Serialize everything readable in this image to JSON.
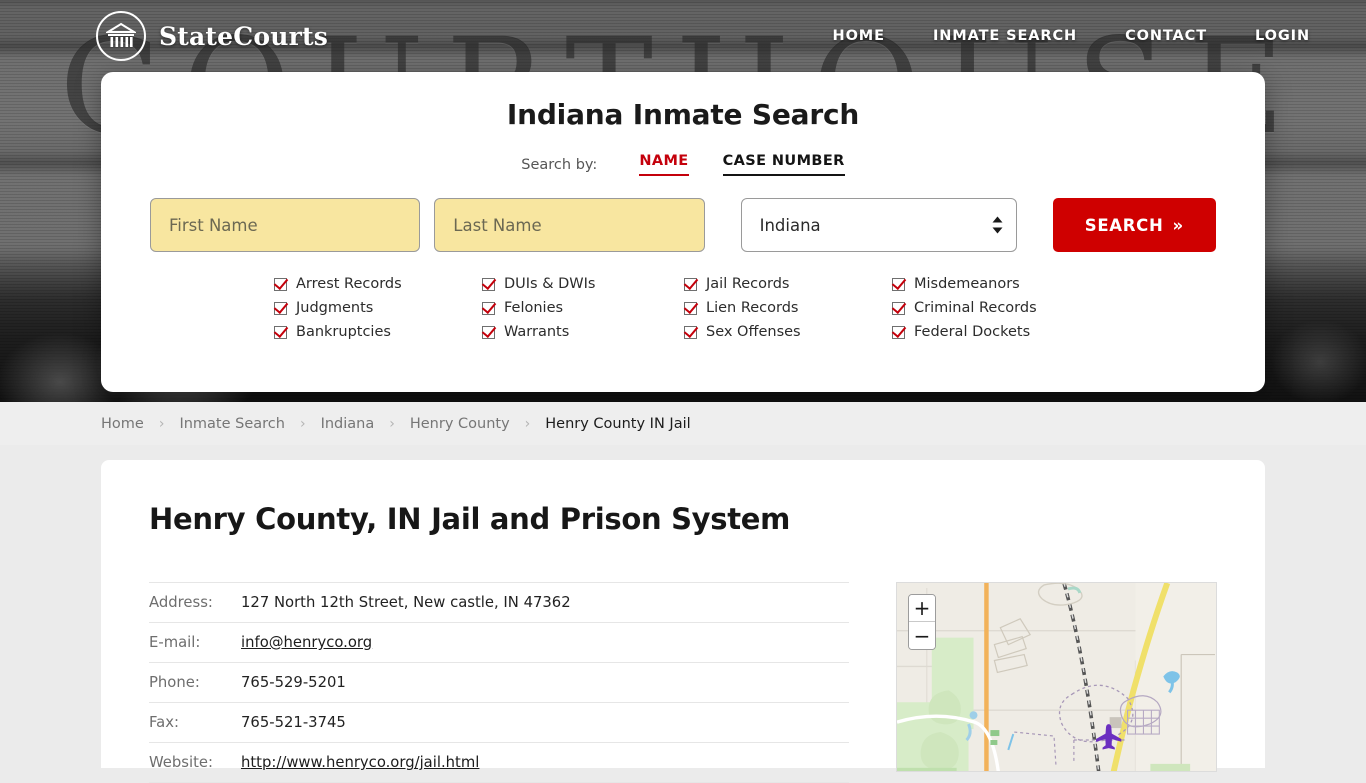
{
  "brand": {
    "name": "StateCourts",
    "logo_icon": "courthouse-circle-icon"
  },
  "nav": [
    {
      "label": "HOME"
    },
    {
      "label": "INMATE SEARCH"
    },
    {
      "label": "CONTACT"
    },
    {
      "label": "LOGIN"
    }
  ],
  "hero": {
    "background_word": "COURTHOUSE"
  },
  "search": {
    "title": "Indiana Inmate Search",
    "search_by_label": "Search by:",
    "tabs": [
      {
        "label": "NAME",
        "active": true
      },
      {
        "label": "CASE NUMBER",
        "active": false
      }
    ],
    "first_name_placeholder": "First Name",
    "last_name_placeholder": "Last Name",
    "state_value": "Indiana",
    "button_label": "SEARCH",
    "button_chevrons": "»",
    "checkboxes": [
      "Arrest Records",
      "DUIs & DWIs",
      "Jail Records",
      "Misdemeanors",
      "Judgments",
      "Felonies",
      "Lien Records",
      "Criminal Records",
      "Bankruptcies",
      "Warrants",
      "Sex Offenses",
      "Federal Dockets"
    ]
  },
  "breadcrumb": {
    "separator": "›",
    "items": [
      {
        "label": "Home",
        "current": false
      },
      {
        "label": "Inmate Search",
        "current": false
      },
      {
        "label": "Indiana",
        "current": false
      },
      {
        "label": "Henry County",
        "current": false
      },
      {
        "label": "Henry County IN Jail",
        "current": true
      }
    ]
  },
  "page": {
    "title": "Henry County, IN Jail and Prison System",
    "info_rows": [
      {
        "label": "Address:",
        "value": "127 North 12th Street, New castle, IN 47362",
        "link": false
      },
      {
        "label": "E-mail:",
        "value": "info@henryco.org",
        "link": true
      },
      {
        "label": "Phone:",
        "value": "765-529-5201",
        "link": false
      },
      {
        "label": "Fax:",
        "value": "765-521-3745",
        "link": false
      },
      {
        "label": "Website:",
        "value": "http://www.henryco.org/jail.html",
        "link": true
      }
    ]
  },
  "map": {
    "zoom_in_label": "+",
    "zoom_out_label": "−"
  },
  "colors": {
    "accent_red": "#c4000b",
    "button_red": "#cf0000",
    "input_yellow": "#f8e6a0",
    "page_bg": "#ebebeb"
  }
}
